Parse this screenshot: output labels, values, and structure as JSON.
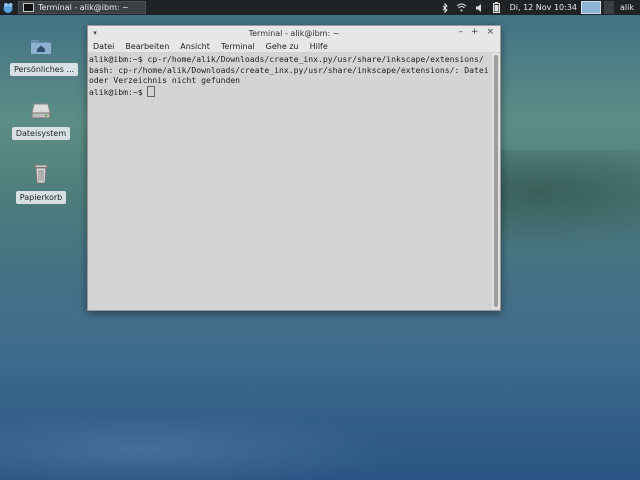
{
  "panel": {
    "task_title": "Terminal - alik@ibm: ~",
    "clock": "Di, 12 Nov  10:34",
    "user": "alik"
  },
  "desktop": {
    "icons": [
      {
        "label": "Persönliches ...",
        "icon": "home-folder-icon"
      },
      {
        "label": "Dateisystem",
        "icon": "drive-icon"
      },
      {
        "label": "Papierkorb",
        "icon": "trash-icon"
      }
    ]
  },
  "terminal": {
    "title": "Terminal - alik@ibm: ~",
    "controls": {
      "minimize": "–",
      "maximize": "+",
      "close": "×"
    },
    "menu": [
      "Datei",
      "Bearbeiten",
      "Ansicht",
      "Terminal",
      "Gehe zu",
      "Hilfe"
    ],
    "lines": [
      "alik@ibm:~$ cp-r/home/alik/Downloads/create_inx.py/usr/share/inkscape/extensions/",
      "bash: cp-r/home/alik/Downloads/create_inx.py/usr/share/inkscape/extensions/: Datei oder Verzeichnis nicht gefunden"
    ],
    "prompt": "alik@ibm:~$ "
  }
}
